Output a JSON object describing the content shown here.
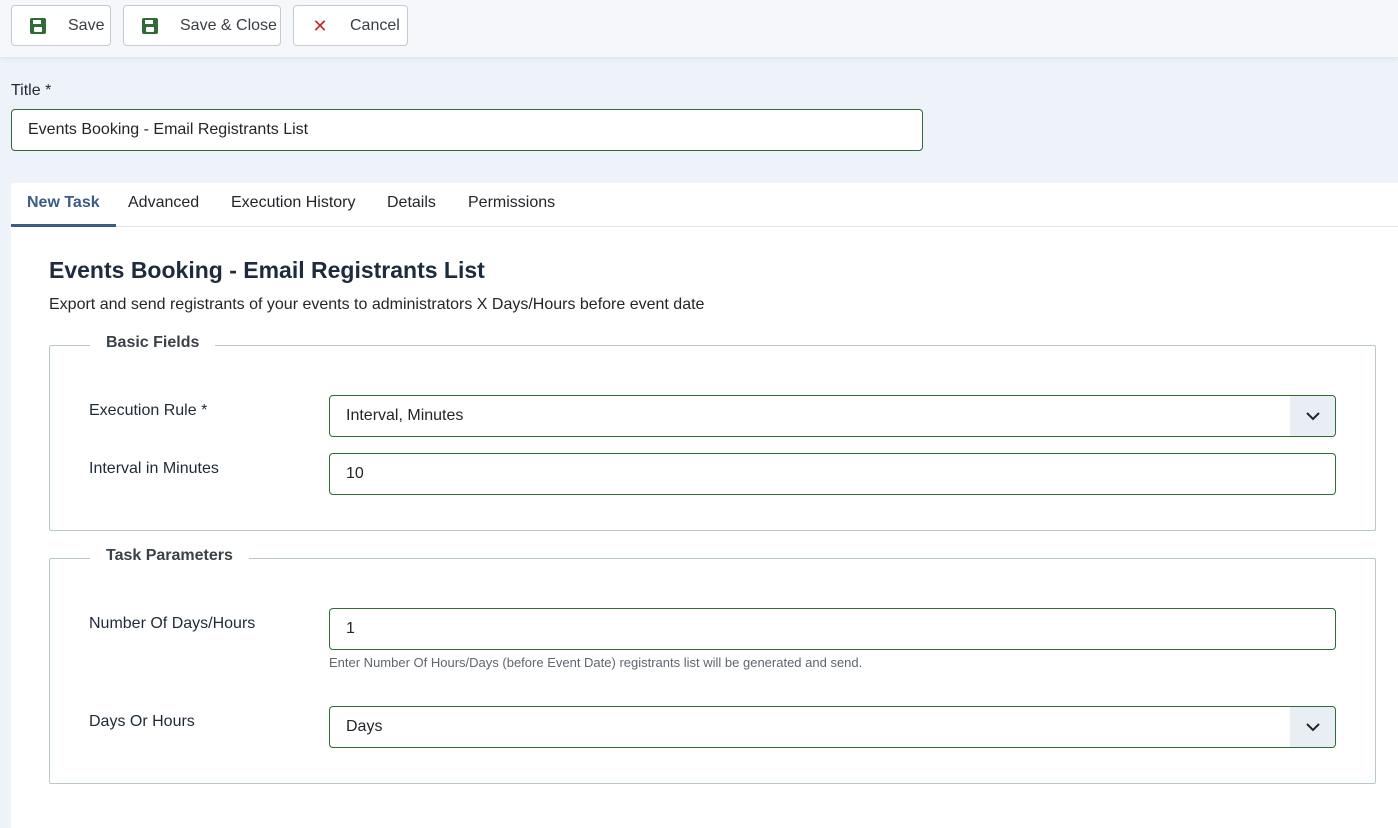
{
  "toolbar": {
    "save_label": "Save",
    "save_close_label": "Save & Close",
    "cancel_label": "Cancel"
  },
  "title_field": {
    "label": "Title *",
    "value": "Events Booking - Email Registrants List"
  },
  "tabs": [
    {
      "label": "New Task",
      "active": true
    },
    {
      "label": "Advanced"
    },
    {
      "label": "Execution History"
    },
    {
      "label": "Details"
    },
    {
      "label": "Permissions"
    }
  ],
  "task": {
    "heading": "Events Booking - Email Registrants List",
    "description": "Export and send registrants of your events to administrators X Days/Hours before event date"
  },
  "basic_fields": {
    "legend": "Basic Fields",
    "execution_rule_label": "Execution Rule *",
    "execution_rule_value": "Interval, Minutes",
    "interval_label": "Interval in Minutes",
    "interval_value": "10"
  },
  "task_parameters": {
    "legend": "Task Parameters",
    "days_hours_label": "Number Of Days/Hours",
    "days_hours_value": "1",
    "days_hours_hint": "Enter Number Of Hours/Days (before Event Date) registrants list will be generated and send.",
    "days_or_hours_label": "Days Or Hours",
    "days_or_hours_value": "Days"
  },
  "colors": {
    "accent": "#3b5c85",
    "input_border": "#2f6b35",
    "cancel_icon": "#c52827"
  }
}
